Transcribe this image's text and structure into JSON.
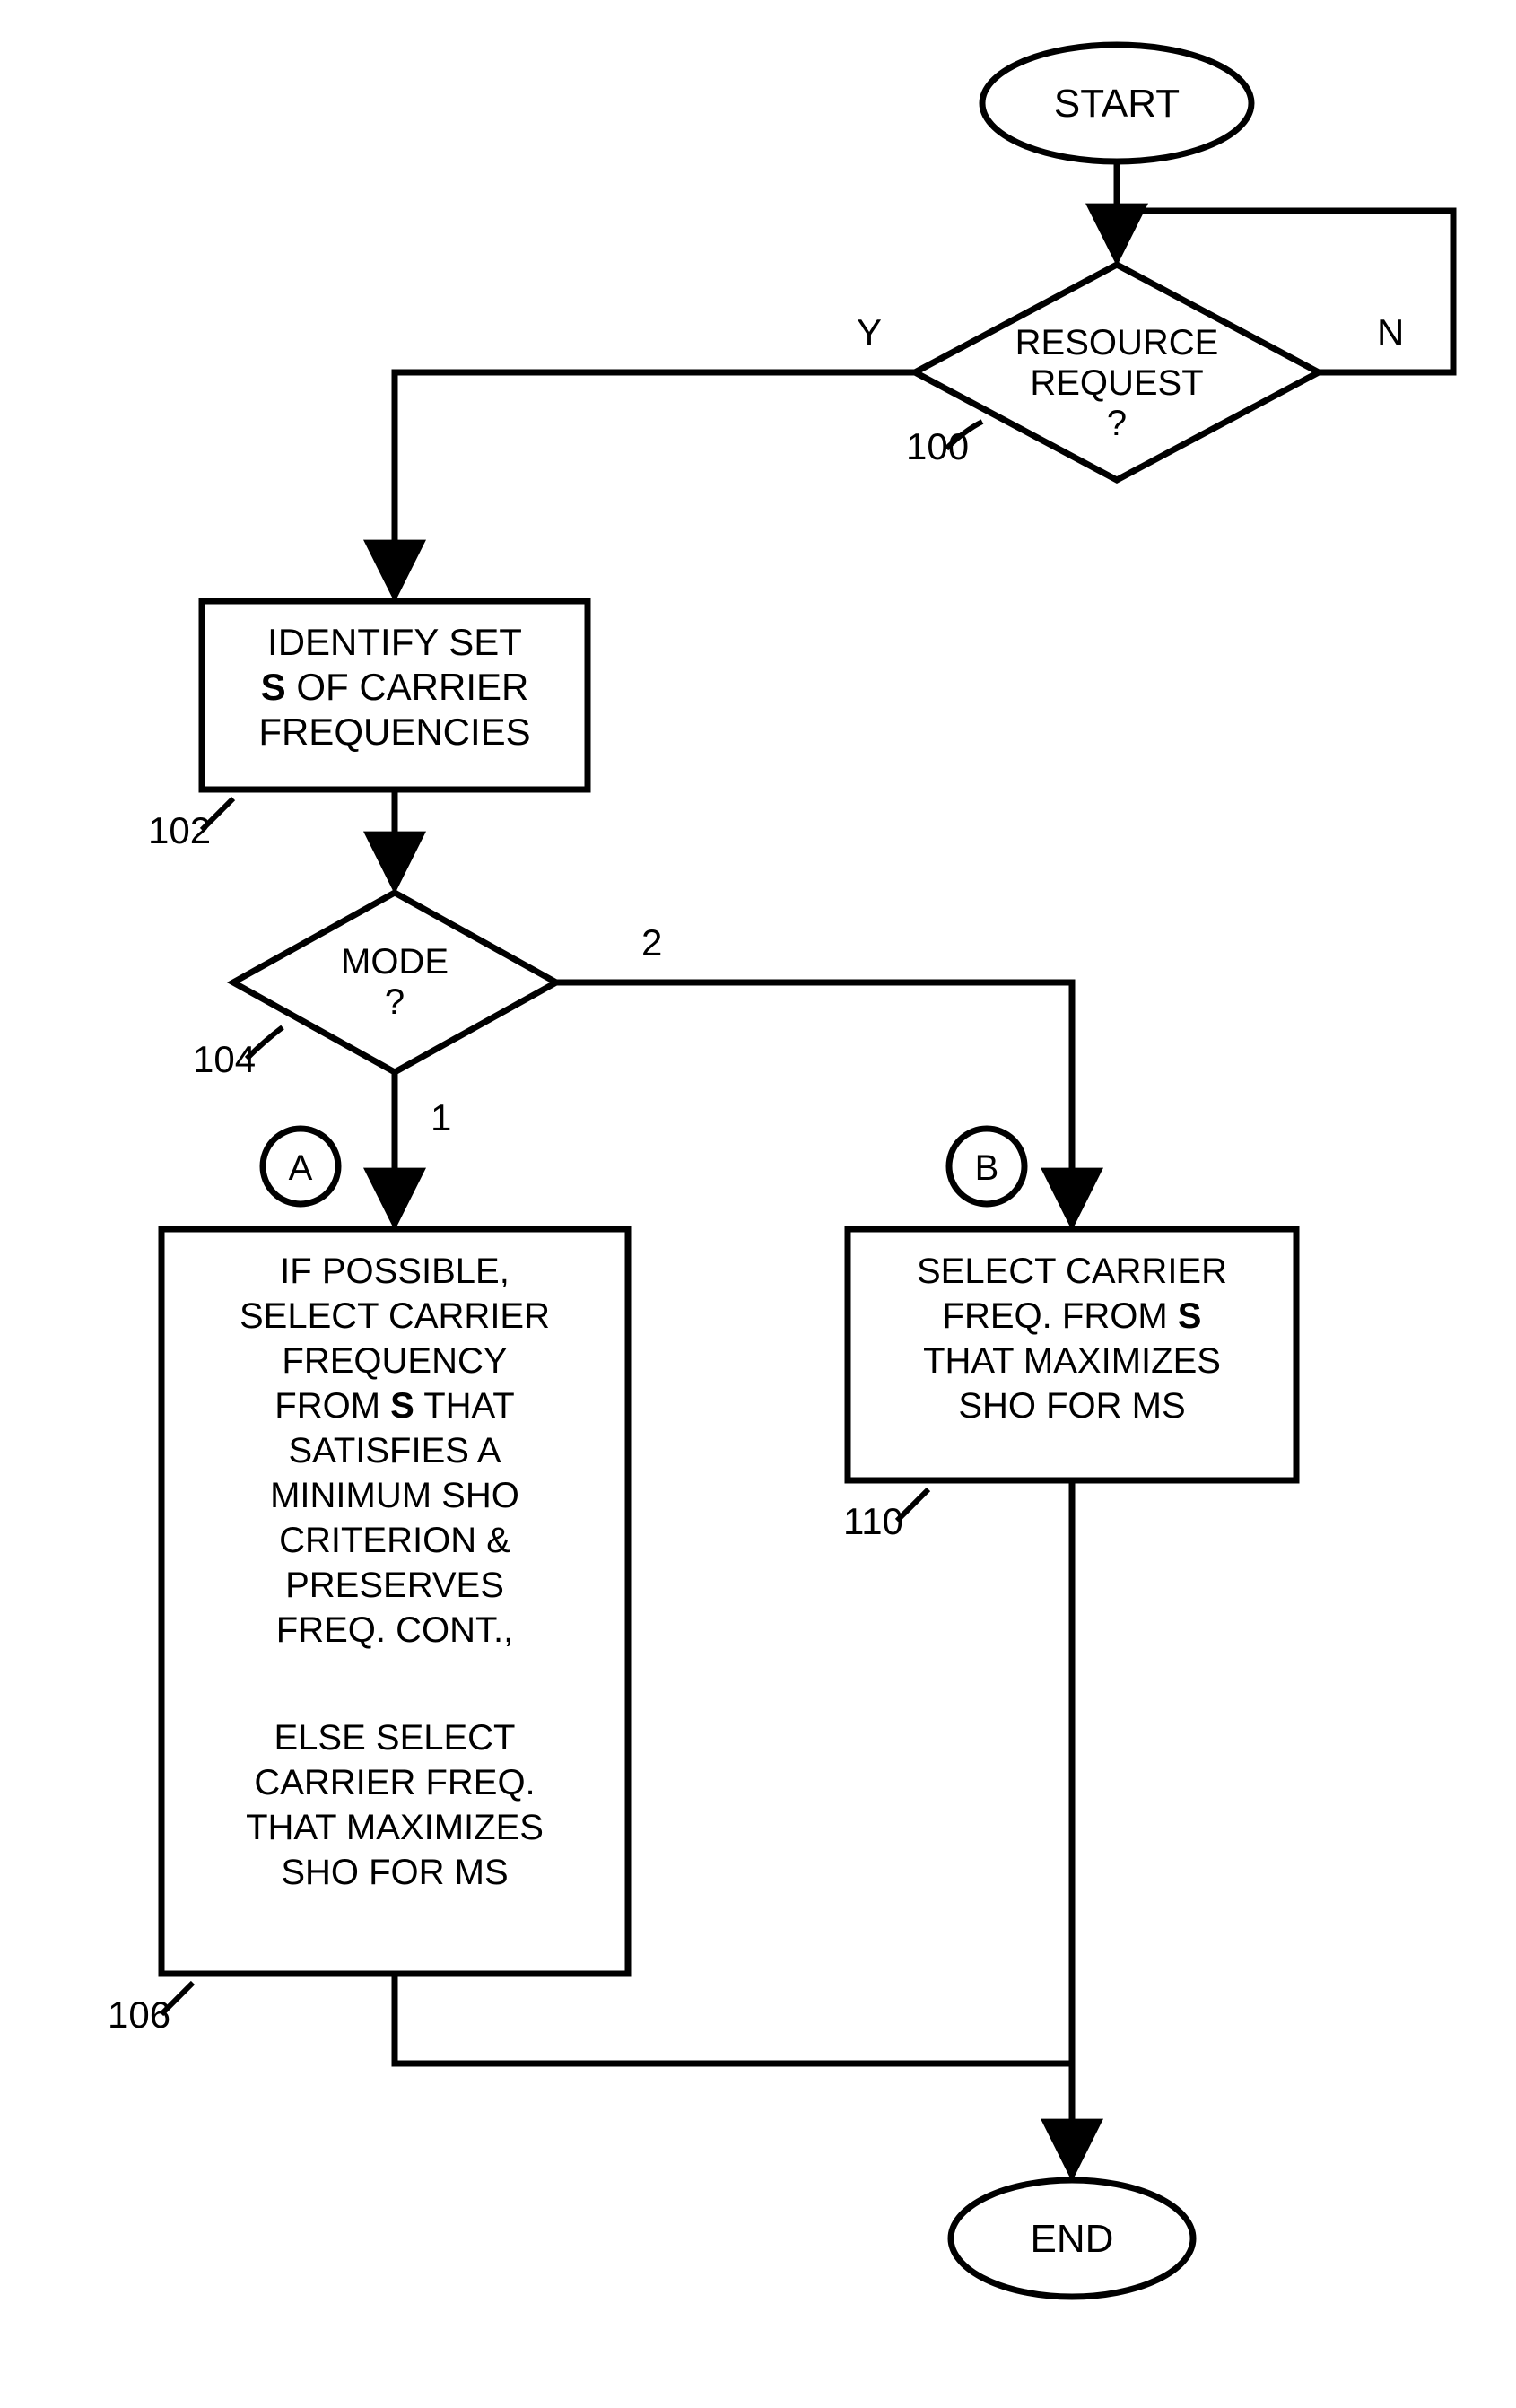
{
  "chart_data": {
    "type": "flowchart",
    "nodes": [
      {
        "id": "start",
        "shape": "terminator",
        "label": "START"
      },
      {
        "id": "n100",
        "shape": "decision",
        "label": "RESOURCE REQUEST ?",
        "ref": "100"
      },
      {
        "id": "n102",
        "shape": "process",
        "label": "IDENTIFY SET S OF CARRIER FREQUENCIES",
        "ref": "102"
      },
      {
        "id": "n104",
        "shape": "decision",
        "label": "MODE ?",
        "ref": "104"
      },
      {
        "id": "A",
        "shape": "connector",
        "label": "A"
      },
      {
        "id": "B",
        "shape": "connector",
        "label": "B"
      },
      {
        "id": "n106",
        "shape": "process",
        "label": "IF POSSIBLE, SELECT CARRIER FREQUENCY FROM S THAT SATISFIES A MINIMUM SHO CRITERION & PRESERVES FREQ. CONT., ELSE SELECT CARRIER FREQ. THAT MAXIMIZES SHO FOR MS",
        "ref": "106"
      },
      {
        "id": "n110",
        "shape": "process",
        "label": "SELECT CARRIER FREQ. FROM S THAT MAXIMIZES SHO FOR MS",
        "ref": "110"
      },
      {
        "id": "end",
        "shape": "terminator",
        "label": "END"
      }
    ],
    "edges": [
      {
        "from": "start",
        "to": "n100"
      },
      {
        "from": "n100",
        "to": "n102",
        "label": "Y"
      },
      {
        "from": "n100",
        "to": "n100",
        "label": "N",
        "loop": true
      },
      {
        "from": "n102",
        "to": "n104"
      },
      {
        "from": "n104",
        "to": "n106",
        "label": "1",
        "via": "A"
      },
      {
        "from": "n104",
        "to": "n110",
        "label": "2",
        "via": "B"
      },
      {
        "from": "n106",
        "to": "end"
      },
      {
        "from": "n110",
        "to": "end"
      }
    ]
  },
  "labels": {
    "start": "START",
    "end": "END",
    "resource_request_l1": "RESOURCE",
    "resource_request_l2": "REQUEST",
    "resource_request_l3": "?",
    "mode_l1": "MODE",
    "mode_l2": "?",
    "Y": "Y",
    "N": "N",
    "one": "1",
    "two": "2",
    "A": "A",
    "B": "B",
    "ref100": "100",
    "ref102": "102",
    "ref104": "104",
    "ref106": "106",
    "ref110": "110",
    "n102_l1": "IDENTIFY SET",
    "n102_l2_a": "S",
    "n102_l2_b": " OF CARRIER",
    "n102_l3": "FREQUENCIES",
    "n106_l1": "IF POSSIBLE,",
    "n106_l2": "SELECT CARRIER",
    "n106_l3": "FREQUENCY",
    "n106_l4_a": "FROM ",
    "n106_l4_b": "S",
    "n106_l4_c": " THAT",
    "n106_l5": "SATISFIES A",
    "n106_l6": "MINIMUM SHO",
    "n106_l7": "CRITERION &",
    "n106_l8": "PRESERVES",
    "n106_l9": "FREQ. CONT.,",
    "n106_l11": "ELSE SELECT",
    "n106_l12": "CARRIER FREQ.",
    "n106_l13": "THAT MAXIMIZES",
    "n106_l14": "SHO FOR MS",
    "n110_l1": "SELECT CARRIER",
    "n110_l2_a": "FREQ. FROM ",
    "n110_l2_b": "S",
    "n110_l3": "THAT MAXIMIZES",
    "n110_l4": "SHO FOR MS"
  }
}
